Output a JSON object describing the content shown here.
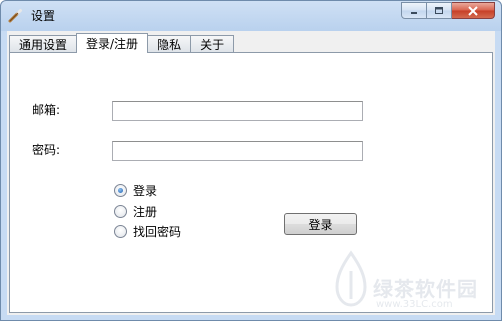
{
  "window": {
    "title": "设置",
    "minimize_icon": "minimize-icon",
    "maximize_icon": "maximize-icon",
    "close_icon": "close-icon"
  },
  "tabs": [
    {
      "label": "通用设置",
      "active": false
    },
    {
      "label": "登录/注册",
      "active": true
    },
    {
      "label": "隐私",
      "active": false
    },
    {
      "label": "关于",
      "active": false
    }
  ],
  "form": {
    "email_label": "邮箱:",
    "email_value": "",
    "password_label": "密码:",
    "password_value": "",
    "options": [
      {
        "label": "登录",
        "checked": true
      },
      {
        "label": "注册",
        "checked": false
      },
      {
        "label": "找回密码",
        "checked": false
      }
    ],
    "submit_label": "登录"
  },
  "watermark": {
    "text": "绿茶软件园",
    "url": "www.33LC.com"
  }
}
